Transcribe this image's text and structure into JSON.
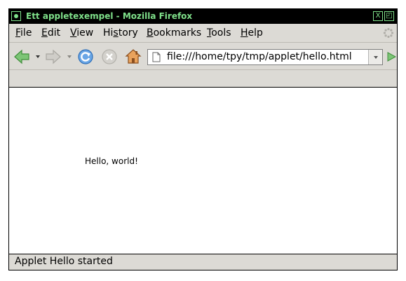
{
  "window": {
    "title": "Ett appletexempel - Mozilla Firefox",
    "buttons": {
      "close": "X",
      "restore": "◰"
    }
  },
  "menubar": {
    "items": [
      {
        "label": "File",
        "accel": "F",
        "rest": "ile"
      },
      {
        "label": "Edit",
        "accel": "E",
        "rest": "dit"
      },
      {
        "label": "View",
        "accel": "V",
        "rest": "iew"
      },
      {
        "label": "History",
        "pre": "Hi",
        "accel": "s",
        "rest": "tory"
      },
      {
        "label": "Bookmarks",
        "accel": "B",
        "rest": "ookmarks"
      },
      {
        "label": "Tools",
        "accel": "T",
        "rest": "ools"
      },
      {
        "label": "Help",
        "accel": "H",
        "rest": "elp"
      }
    ]
  },
  "navbar": {
    "icons": [
      "back-icon",
      "forward-icon",
      "reload-icon",
      "stop-icon",
      "home-icon"
    ],
    "url": "file:///home/tpy/tmp/applet/hello.html"
  },
  "content": {
    "applet_text": "Hello, world!"
  },
  "statusbar": {
    "text": "Applet Hello started"
  },
  "colors": {
    "titlebar_bg": "#000000",
    "titlebar_fg": "#7fe08a",
    "chrome_bg": "#dcdad5",
    "content_bg": "#ffffff"
  }
}
